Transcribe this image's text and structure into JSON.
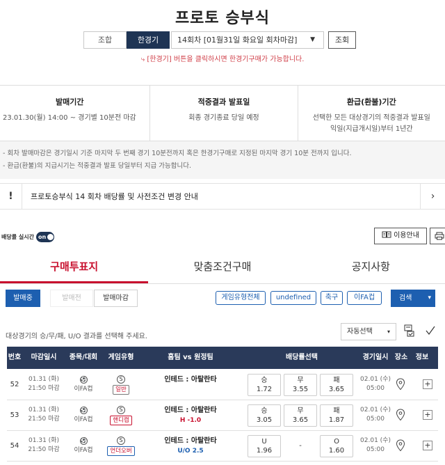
{
  "page": {
    "title": "프로토 승부식"
  },
  "selector": {
    "tab_lookup": "조합",
    "tab_limit": "한경기",
    "round_select": "14회차 [01월31일 화요일 회차마감]",
    "lookup_button": "조회",
    "hint": "⤷ [한경기] 버튼을 클릭하시면 한경기구매가 가능합니다."
  },
  "info": {
    "sale_period_label": "발매기간",
    "sale_period_value": "23.01.30(월) 14:00 ~ 경기별 10분전 마감",
    "result_label": "적중결과 발표일",
    "result_value": "회종 경기종료 당일 예정",
    "refund_label": "환급(환불)기간",
    "refund_value_1": "선택한 모든 대상경기의 적중결과 발표일",
    "refund_value_2": "익일(지급개시일)부터 1년간"
  },
  "notes": {
    "line1": "- 회차 발매마감은 경기일시 기준 마지막 두 번째 경기 10분전까지 혹은 한경기구매로 지정된 마지막 경기 10분 전까지 입니다.",
    "line2": "- 환급(환불)의 지급시기는 적중결과 발표 당일부터 지급 가능합니다."
  },
  "notice": {
    "bang": "!",
    "text": "프로토승부식 14 회차 배당률 및 사전조건 변경 안내",
    "chevron": "›"
  },
  "realtime": {
    "label": "배당률 실시간",
    "toggle": "on"
  },
  "buttons": {
    "guide": "이용안내",
    "guide_icon": "book-icon",
    "print_icon": "printer-icon"
  },
  "tabs": [
    {
      "label": "구매투표지",
      "active": true
    },
    {
      "label": "맞춤조건구매",
      "active": false
    },
    {
      "label": "공지사항",
      "active": false
    }
  ],
  "status_buttons": {
    "on_sale": "발매중",
    "before": "발매전",
    "closed": "발매마감"
  },
  "filters": {
    "game_type_all": "게임유형전체",
    "undefined_chip": "undefined",
    "soccer": "축구",
    "league": "이FA컵"
  },
  "search": {
    "label": "검색",
    "caret": "▾"
  },
  "instruction": "대상경기의 승/무/패, U/O 결과를 선택해 주세요.",
  "auto_select": {
    "label": "자동선택",
    "caret": "▾"
  },
  "columns": [
    "번호",
    "마감일시",
    "종목/대회",
    "게임유형",
    "홈팀 vs 원정팀",
    "배당률선택",
    "경기일시",
    "장소",
    "정보"
  ],
  "matches": [
    {
      "no": "52",
      "deadline_date": "01.31 (화)",
      "deadline_time": "21:50 마감",
      "league": "이FA컵",
      "game_icon": "S",
      "game_type": "일반",
      "game_style": "normal",
      "match": "인테드 : 아탈란타",
      "sub": "",
      "sub_style": "",
      "odds": [
        {
          "label": "승",
          "value": "1.72"
        },
        {
          "label": "무",
          "value": "3.55"
        },
        {
          "label": "패",
          "value": "3.65"
        }
      ],
      "game_date": "02.01 (수)",
      "game_time": "05:00"
    },
    {
      "no": "53",
      "deadline_date": "01.31 (화)",
      "deadline_time": "21:50 마감",
      "league": "이FA컵",
      "game_icon": "S",
      "game_type": "핸디캡",
      "game_style": "handicap",
      "match": "인테드 : 아탈란타",
      "sub": "H -1.0",
      "sub_style": "red",
      "odds": [
        {
          "label": "승",
          "value": "3.05"
        },
        {
          "label": "무",
          "value": "3.65"
        },
        {
          "label": "패",
          "value": "1.87"
        }
      ],
      "game_date": "02.01 (수)",
      "game_time": "05:00"
    },
    {
      "no": "54",
      "deadline_date": "01.31 (화)",
      "deadline_time": "21:50 마감",
      "league": "이FA컵",
      "game_icon": "S",
      "game_type": "언더오버",
      "game_style": "uo",
      "match": "인테드 : 아탈란타",
      "sub": "U/O 2.5",
      "sub_style": "blue",
      "odds": [
        {
          "label": "U",
          "value": "1.96"
        },
        {
          "label": "",
          "value": "-"
        },
        {
          "label": "O",
          "value": "1.60"
        }
      ],
      "game_date": "02.01 (수)",
      "game_time": "05:00"
    }
  ]
}
